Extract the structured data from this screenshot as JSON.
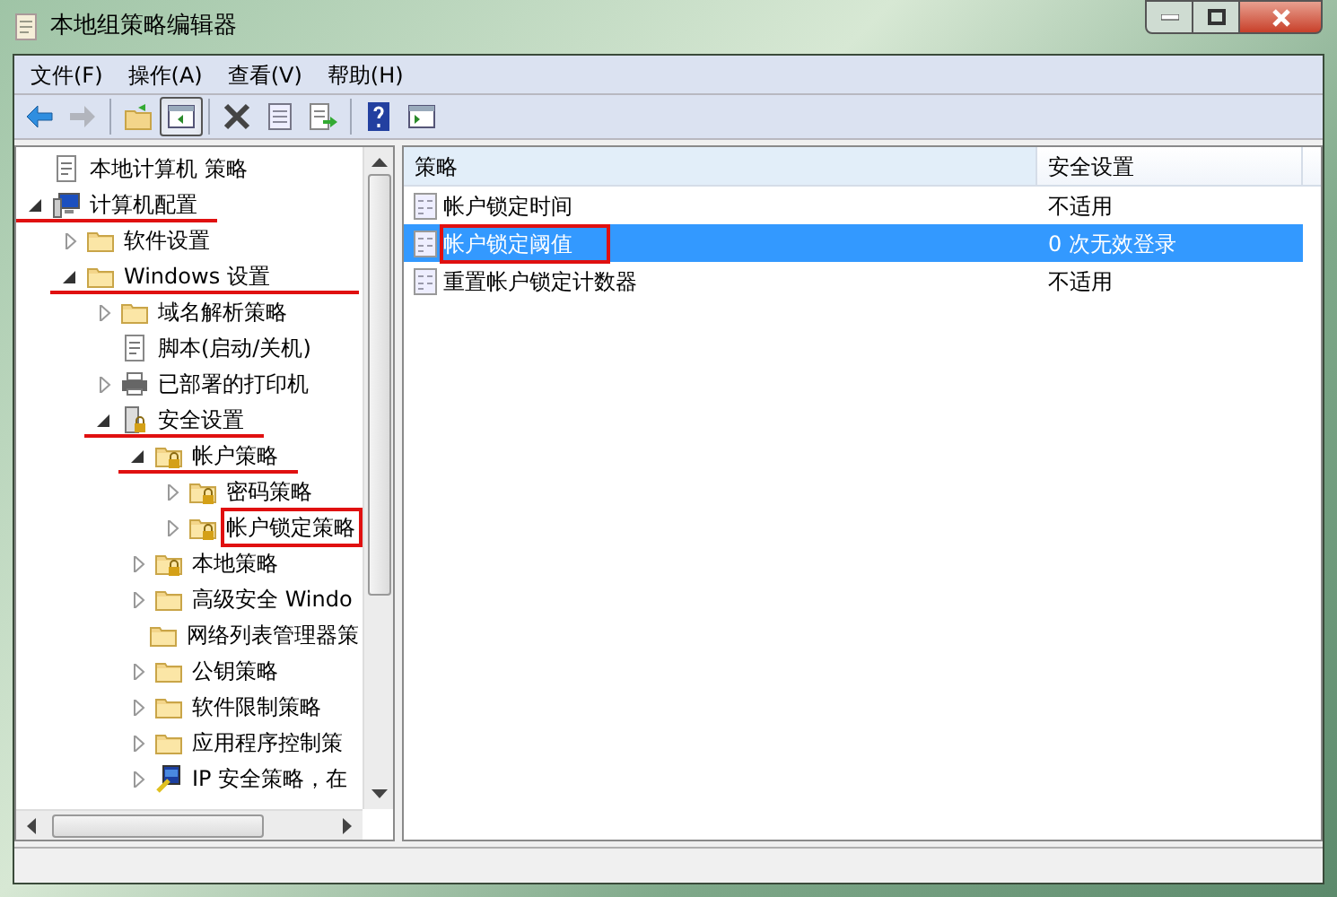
{
  "window": {
    "title": "本地组策略编辑器"
  },
  "menu": [
    "文件(F)",
    "操作(A)",
    "查看(V)",
    "帮助(H)"
  ],
  "toolbar": [
    {
      "kind": "back",
      "disabled": false,
      "pressed": false
    },
    {
      "kind": "forward",
      "disabled": true,
      "pressed": false
    },
    {
      "kind": "sep"
    },
    {
      "kind": "up",
      "disabled": false,
      "pressed": false
    },
    {
      "kind": "tree",
      "disabled": false,
      "pressed": true
    },
    {
      "kind": "sep"
    },
    {
      "kind": "delete",
      "disabled": false,
      "pressed": false
    },
    {
      "kind": "properties",
      "disabled": false,
      "pressed": false
    },
    {
      "kind": "export",
      "disabled": false,
      "pressed": false
    },
    {
      "kind": "sep"
    },
    {
      "kind": "help",
      "disabled": false,
      "pressed": false
    },
    {
      "kind": "action",
      "disabled": false,
      "pressed": false
    }
  ],
  "tree": [
    {
      "label": "本地计算机 策略",
      "kind": "script",
      "underlined": false,
      "boxed": false,
      "children": [
        {
          "label": "计算机配置",
          "kind": "computer",
          "expanded": true,
          "underlined": true,
          "boxed": false,
          "children": [
            {
              "label": "软件设置",
              "kind": "folder",
              "expanded": false,
              "underlined": false,
              "boxed": false
            },
            {
              "label": "Windows 设置",
              "kind": "folder",
              "expanded": true,
              "underlined": true,
              "boxed": false,
              "children": [
                {
                  "label": "域名解析策略",
                  "kind": "folder",
                  "expanded": false,
                  "underlined": false,
                  "boxed": false
                },
                {
                  "label": "脚本(启动/关机)",
                  "kind": "script",
                  "underlined": false,
                  "boxed": false
                },
                {
                  "label": "已部署的打印机",
                  "kind": "printer",
                  "expanded": false,
                  "underlined": false,
                  "boxed": false
                },
                {
                  "label": "安全设置",
                  "kind": "server",
                  "expanded": true,
                  "underlined": true,
                  "boxed": false,
                  "children": [
                    {
                      "label": "帐户策略",
                      "kind": "lockfolder",
                      "expanded": true,
                      "underlined": true,
                      "boxed": false,
                      "children": [
                        {
                          "label": "密码策略",
                          "kind": "lockfolder",
                          "expanded": false,
                          "underlined": false,
                          "boxed": false
                        },
                        {
                          "label": "帐户锁定策略",
                          "kind": "lockfolder",
                          "expanded": false,
                          "underlined": false,
                          "boxed": true
                        }
                      ]
                    },
                    {
                      "label": "本地策略",
                      "kind": "lockfolder",
                      "expanded": false,
                      "underlined": false,
                      "boxed": false
                    },
                    {
                      "label": "高级安全 Windo",
                      "kind": "folder",
                      "expanded": false,
                      "underlined": false,
                      "boxed": false
                    },
                    {
                      "label": "网络列表管理器策",
                      "kind": "folder",
                      "underlined": false,
                      "boxed": false
                    },
                    {
                      "label": "公钥策略",
                      "kind": "folder",
                      "expanded": false,
                      "underlined": false,
                      "boxed": false
                    },
                    {
                      "label": "软件限制策略",
                      "kind": "folder",
                      "expanded": false,
                      "underlined": false,
                      "boxed": false
                    },
                    {
                      "label": "应用程序控制策",
                      "kind": "folder",
                      "expanded": false,
                      "underlined": false,
                      "boxed": false
                    },
                    {
                      "label": "IP 安全策略，在",
                      "kind": "ip",
                      "expanded": false,
                      "underlined": false,
                      "boxed": false
                    }
                  ]
                }
              ]
            }
          ]
        }
      ]
    }
  ],
  "table": {
    "columns": [
      "策略",
      "安全设置"
    ],
    "rows": [
      {
        "policy": "帐户锁定时间",
        "setting": "不适用",
        "selected": false,
        "boxed": false
      },
      {
        "policy": "帐户锁定阈值",
        "setting": "0 次无效登录",
        "selected": true,
        "boxed": true
      },
      {
        "policy": "重置帐户锁定计数器",
        "setting": "不适用",
        "selected": false,
        "boxed": false
      }
    ]
  }
}
